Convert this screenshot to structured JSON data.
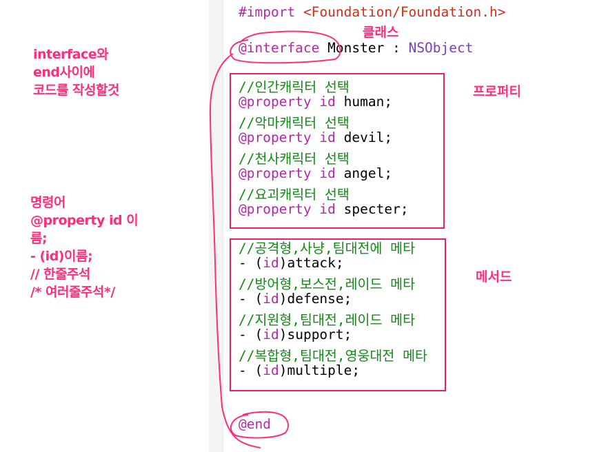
{
  "notes": {
    "left_top": [
      "interface와",
      "end사이에",
      "코드를 작성할것"
    ],
    "left_mid": [
      "명령어",
      "@property id 이",
      "름;",
      "- (id)이름;",
      "// 한줄주석",
      "/* 여러줄주석*/"
    ],
    "class_label": "클래스",
    "property_label": "프로퍼티",
    "method_label": "메서드"
  },
  "code": {
    "import_directive": "#import",
    "import_path": "<Foundation/Foundation.h>",
    "interface_kw": "@interface",
    "class_name": "Monster",
    "colon": " : ",
    "superclass": "NSObject",
    "property_kw": "@property",
    "id_kw": "id",
    "properties": [
      {
        "comment": "//인간캐릭터 선택",
        "name": " human;"
      },
      {
        "comment": "//악마캐릭터 선택",
        "name": " devil;"
      },
      {
        "comment": "//천사캐릭터 선택",
        "name": " angel;"
      },
      {
        "comment": "//요괴캐릭터 선택",
        "name": " specter;"
      }
    ],
    "method_prefix": "- (",
    "method_close": ")",
    "methods": [
      {
        "comment": "//공격형,사냥,팀대전에 메타",
        "name": "attack;"
      },
      {
        "comment": "//방어형,보스전,레이드 메타",
        "name": "defense;"
      },
      {
        "comment": "//지원형,팀대전,레이드 메타",
        "name": "support;"
      },
      {
        "comment": "//복합형,팀대전,영웅대전 메타",
        "name": "multiple;"
      }
    ],
    "end_kw": "@end"
  },
  "colors": {
    "annotation": "#ff2d7a",
    "keyword": "#b329a3",
    "string": "#d12f1b",
    "type": "#7c3fb8",
    "comment": "#118a14"
  }
}
